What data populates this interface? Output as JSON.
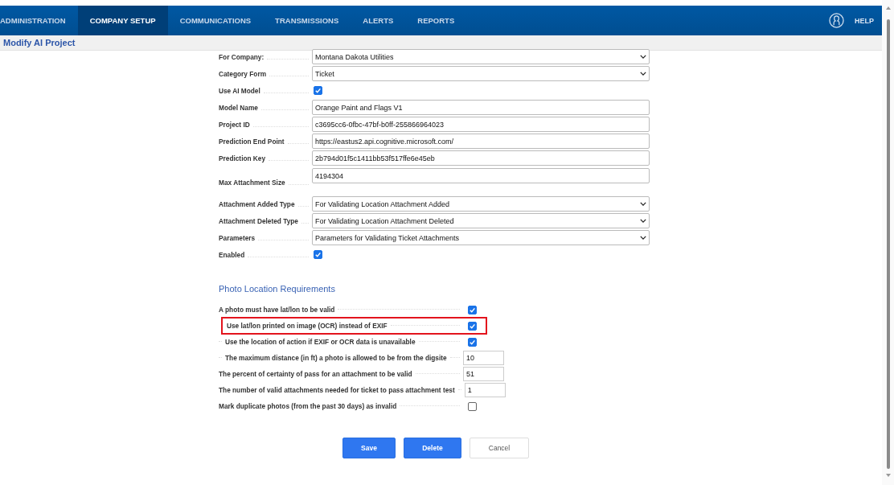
{
  "nav": {
    "tabs": [
      {
        "label": "ADMINISTRATION",
        "selected": false
      },
      {
        "label": "COMPANY SETUP",
        "selected": true
      },
      {
        "label": "COMMUNICATIONS",
        "selected": false
      },
      {
        "label": "TRANSMISSIONS",
        "selected": false
      },
      {
        "label": "ALERTS",
        "selected": false
      },
      {
        "label": "REPORTS",
        "selected": false
      }
    ],
    "help": "HELP"
  },
  "page_title": "Modify AI Project",
  "form": [
    {
      "label": "For Company:",
      "kind": "select",
      "value": "Montana Dakota Utilities"
    },
    {
      "label": "Category Form",
      "kind": "select",
      "value": "Ticket"
    },
    {
      "label": "Use AI Model",
      "kind": "checkbox",
      "checked": true
    },
    {
      "label": "Model Name",
      "kind": "text",
      "value": "Orange Paint and Flags V1"
    },
    {
      "label": "Project ID",
      "kind": "text",
      "value": "c3695cc6-0fbc-47bf-b0ff-255866964023"
    },
    {
      "label": "Prediction End Point",
      "kind": "text",
      "value": "https://eastus2.api.cognitive.microsoft.com/"
    },
    {
      "label": "Prediction Key",
      "kind": "text",
      "value": "2b794d01f5c1411bb53f517ffe6e45eb"
    },
    {
      "label": "Max Attachment Size",
      "kind": "text",
      "value": "4194304"
    },
    {
      "label": "Attachment Added Type",
      "kind": "select",
      "value": "For Validating Location Attachment Added"
    },
    {
      "label": "Attachment Deleted Type",
      "kind": "select",
      "value": "For Validating Location Attachment Deleted"
    },
    {
      "label": "Parameters",
      "kind": "select",
      "value": "Parameters for Validating Ticket Attachments"
    },
    {
      "label": "Enabled",
      "kind": "checkbox",
      "checked": true
    }
  ],
  "photo_section": {
    "title": "Photo Location Requirements",
    "rows": [
      {
        "label": "A photo must have lat/lon to be valid",
        "kind": "checkbox",
        "checked": true,
        "highlighted": false,
        "children": [
          {
            "label": "Use lat/lon printed on image (OCR) instead of EXIF",
            "kind": "checkbox",
            "checked": true,
            "highlighted": true
          },
          {
            "label": "Use the location of action if EXIF or OCR data is unavailable",
            "kind": "checkbox",
            "checked": true,
            "highlighted": false
          },
          {
            "label": "The maximum distance (in ft) a photo is allowed to be from the digsite",
            "kind": "text",
            "value": "10",
            "highlighted": false
          }
        ]
      },
      {
        "label": "The percent of certainty of pass for an attachment to be valid",
        "kind": "text",
        "value": "51",
        "highlighted": false
      },
      {
        "label": "The number of valid attachments needed for ticket to pass attachment test",
        "kind": "text",
        "value": "1",
        "highlighted": false
      },
      {
        "label": "Mark duplicate photos (from the past 30 days) as invalid",
        "kind": "checkbox",
        "checked": false,
        "highlighted": false
      }
    ]
  },
  "buttons": [
    {
      "label": "Save",
      "kind": "primary"
    },
    {
      "label": "Delete",
      "kind": "primary"
    },
    {
      "label": "Cancel",
      "kind": "secondary"
    }
  ]
}
